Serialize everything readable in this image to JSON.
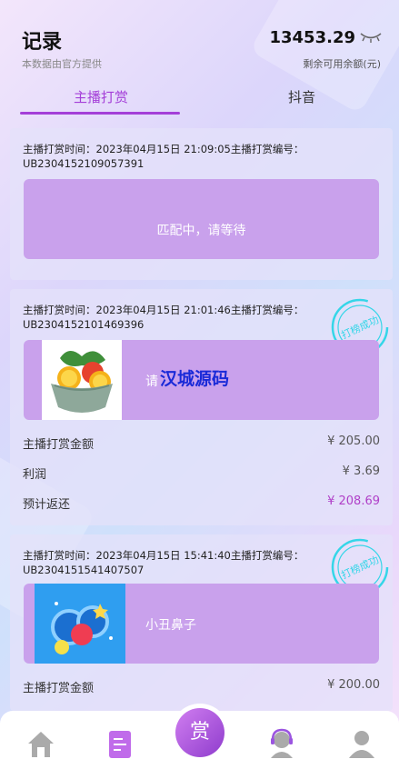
{
  "header": {
    "title": "记录",
    "subtitle": "本数据由官方提供",
    "balance": "13453.29",
    "balance_label": "剩余可用余额(元)"
  },
  "tabs": [
    {
      "label": "主播打赏",
      "active": true
    },
    {
      "label": "抖音",
      "active": false
    }
  ],
  "records": [
    {
      "meta_line1": "主播打赏时间：2023年04月15日 21:09:05主播打赏编号：",
      "meta_line2": "UB2304152109057391",
      "status_text": "匹配中，请等待"
    },
    {
      "meta_line1": "主播打赏时间：2023年04月15日 21:01:46主播打赏编号：",
      "meta_line2": "UB2304152101469396",
      "product_image": "fruit-bowl",
      "product_name_partial": "请",
      "watermark": "汉城源码",
      "stamp": "打榜成功",
      "amount_label": "主播打赏金额",
      "amount": "¥ 205.00",
      "profit_label": "利润",
      "profit": "¥ 3.69",
      "return_label": "预计返还",
      "return_value": "¥ 208.69"
    },
    {
      "meta_line1": "主播打赏时间：2023年04月15日 15:41:40主播打赏编号：",
      "meta_line2": "UB2304151541407507",
      "product_image": "clown-nose",
      "product_name": "小丑鼻子",
      "stamp": "打榜成功",
      "amount_label": "主播打赏金额",
      "amount": "¥ 200.00"
    }
  ],
  "bottom_nav": {
    "items": [
      "home-icon",
      "records-icon",
      "reward-center-icon",
      "support-icon",
      "profile-icon"
    ],
    "center_label": "赏"
  },
  "colors": {
    "accent": "#a43fd8",
    "product_box": "#c9a1ec",
    "stamp": "#35d6e8",
    "watermark": "#1a2ad8",
    "return_value": "#b040c8"
  }
}
